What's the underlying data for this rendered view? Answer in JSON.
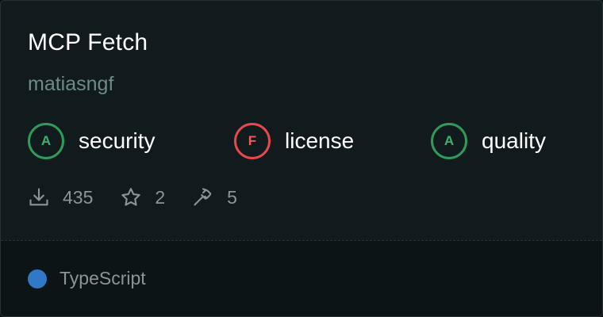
{
  "card": {
    "title": "MCP Fetch",
    "author": "matiasngf",
    "grades": [
      {
        "letter": "A",
        "label": "security",
        "status": "good",
        "color": "#2f9a5b"
      },
      {
        "letter": "F",
        "label": "license",
        "status": "bad",
        "color": "#e5484d"
      },
      {
        "letter": "A",
        "label": "quality",
        "status": "good",
        "color": "#2f9a5b"
      }
    ],
    "stats": {
      "downloads": {
        "icon": "download-icon",
        "value": "435"
      },
      "stars": {
        "icon": "star-icon",
        "value": "2"
      },
      "tools": {
        "icon": "hammer-icon",
        "value": "5"
      }
    },
    "language": {
      "name": "TypeScript",
      "color": "#3178c6"
    }
  }
}
